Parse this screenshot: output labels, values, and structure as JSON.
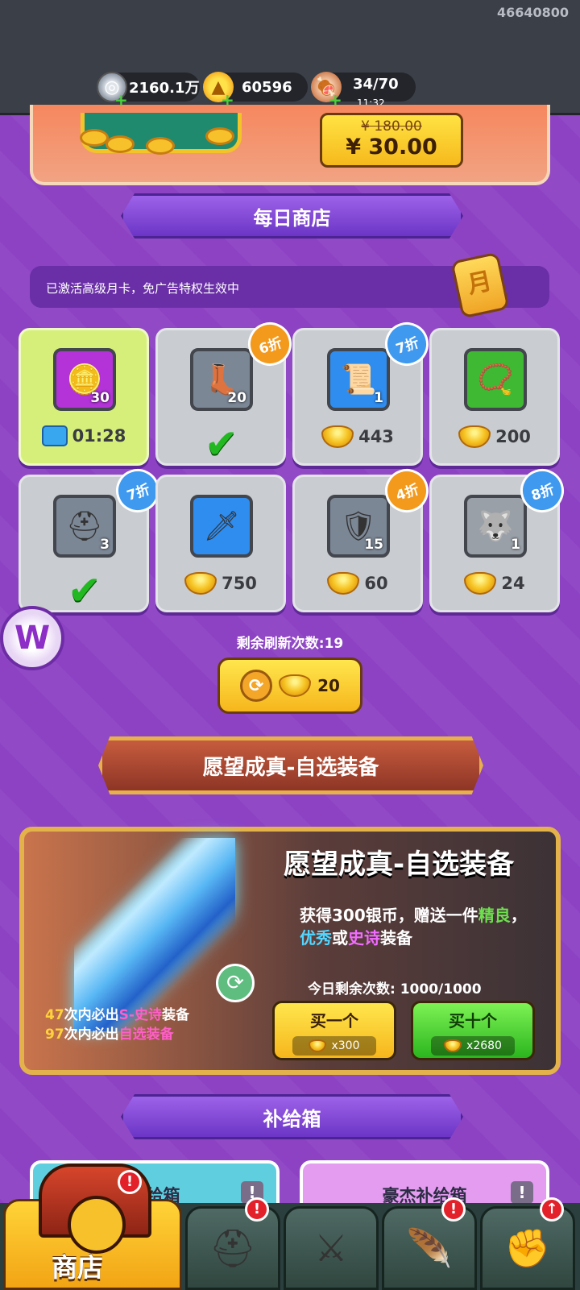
{
  "user_id": "46640800",
  "resources": {
    "silver": "2160.1万",
    "gold": "60596",
    "stamina": "34/70",
    "stamina_timer": "11:32",
    "add_symbol": "+"
  },
  "promo": {
    "old_price": "¥ 180.00",
    "price": "¥ 30.00"
  },
  "daily_shop": {
    "title": "每日商店",
    "notice": "已激活高级月卡，免广告特权生效中",
    "items": [
      {
        "icon": "gold-ingot-icon",
        "glyph": "🪙",
        "qty": "30",
        "cost": "01:28",
        "discount": "",
        "purchased": false,
        "cost_type": "ad-video"
      },
      {
        "icon": "boots-gem-icon",
        "glyph": "👢",
        "qty": "20",
        "cost": "",
        "discount": "6折",
        "purchased": true
      },
      {
        "icon": "scroll-icon",
        "glyph": "📜",
        "qty": "1",
        "cost": "443",
        "discount": "7折",
        "purchased": false
      },
      {
        "icon": "necklace-icon",
        "glyph": "📿",
        "qty": "",
        "cost": "200",
        "discount": "",
        "purchased": false
      },
      {
        "icon": "helmet-gem-icon",
        "glyph": "⛑",
        "qty": "3",
        "cost": "",
        "discount": "7折",
        "purchased": true
      },
      {
        "icon": "dagger-icon",
        "glyph": "🗡",
        "qty": "",
        "cost": "750",
        "discount": "",
        "purchased": false
      },
      {
        "icon": "armor-gem-icon",
        "glyph": "🛡",
        "qty": "15",
        "cost": "60",
        "discount": "4折",
        "purchased": false
      },
      {
        "icon": "wolf-emblem-icon",
        "glyph": "🐺",
        "qty": "1",
        "cost": "24",
        "discount": "8折",
        "purchased": false
      }
    ],
    "refresh_label": "剩余刷新次数:19",
    "refresh_cost": "20"
  },
  "wish": {
    "banner": "愿望成真-自选装备",
    "title": "愿望成真-自选装备",
    "desc_prefix": "获得300银币，赠送一件",
    "desc_good": "精良",
    "desc_sep": "，",
    "desc_excellent": "优秀",
    "desc_or": "或",
    "desc_epic": "史诗",
    "desc_suffix": "装备",
    "remaining": "今日剩余次数: 1000/1000",
    "pity1_num": "47",
    "pity1_mid": "次内必出",
    "pity1_tag": "S-史诗",
    "pity1_end": "装备",
    "pity2_num": "97",
    "pity2_mid": "次内必出",
    "pity2_tag": "自选装备",
    "buy_one_label": "买一个",
    "buy_one_cost": "x300",
    "buy_ten_label": "买十个",
    "buy_ten_cost": "x2680"
  },
  "supply": {
    "title": "补给箱",
    "normal_name": "补给箱",
    "hero_name": "豪杰补给箱",
    "info_symbol": "!"
  },
  "nav": {
    "shop_label": "商店",
    "alert_symbol": "!",
    "upgrade_symbol": "↑"
  },
  "colors": {
    "background": "#8d42c4",
    "accent_gold": "#f6c12a",
    "discount_orange": "#f39a1d",
    "discount_blue": "#3e99ef"
  }
}
